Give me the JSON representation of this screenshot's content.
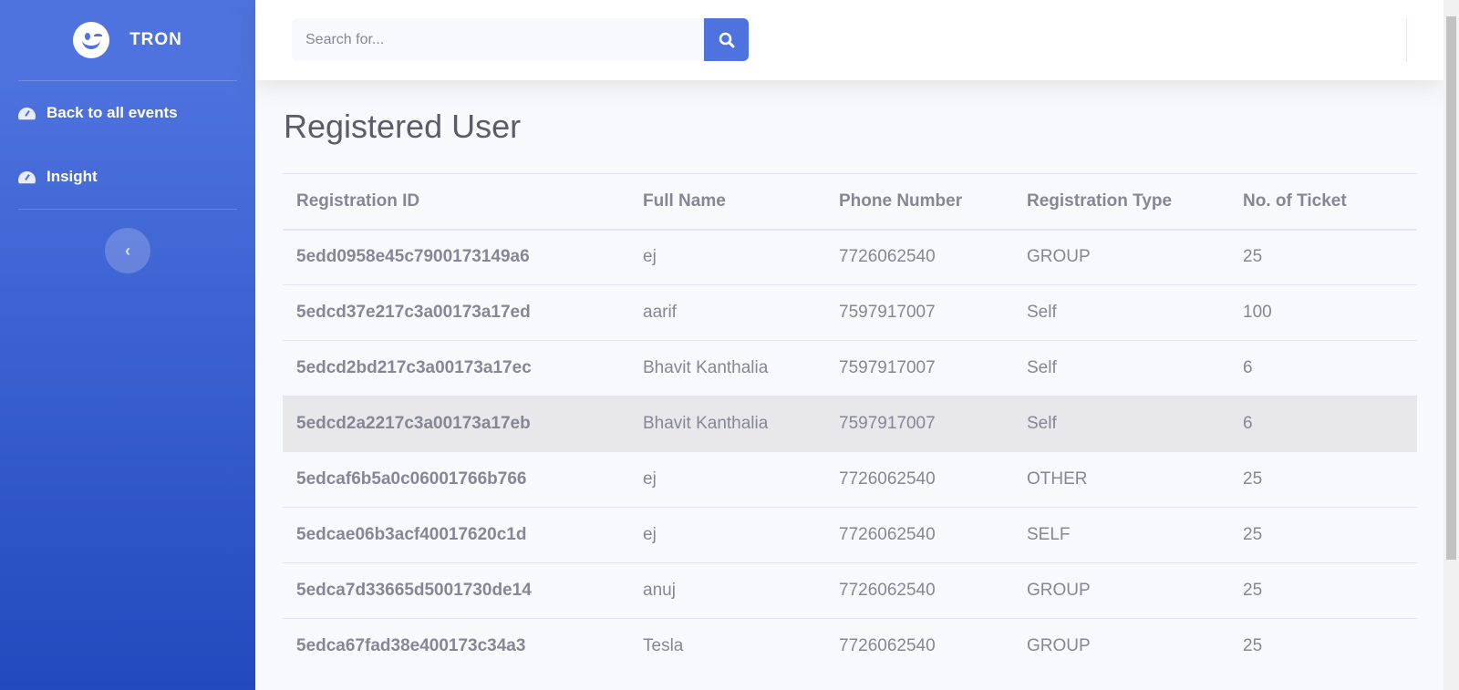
{
  "brand": {
    "name": "TRON",
    "logo_icon": "winking-face-icon"
  },
  "sidebar": {
    "items": [
      {
        "label": "Back to all events",
        "icon": "tachometer-icon"
      },
      {
        "label": "Insight",
        "icon": "tachometer-icon"
      }
    ],
    "toggle_icon": "chevron-left-icon",
    "toggle_glyph": "‹"
  },
  "search": {
    "placeholder": "Search for...",
    "value": "",
    "icon": "search-icon"
  },
  "main": {
    "title": "Registered User",
    "table": {
      "headers": [
        "Registration ID",
        "Full Name",
        "Phone Number",
        "Registration Type",
        "No. of Ticket"
      ],
      "rows": [
        [
          "5edd0958e45c7900173149a6",
          "ej",
          "7726062540",
          "GROUP",
          "25"
        ],
        [
          "5edcd37e217c3a00173a17ed",
          "aarif",
          "7597917007",
          "Self",
          "100"
        ],
        [
          "5edcd2bd217c3a00173a17ec",
          "Bhavit Kanthalia",
          "7597917007",
          "Self",
          "6"
        ],
        [
          "5edcd2a2217c3a00173a17eb",
          "Bhavit Kanthalia",
          "7597917007",
          "Self",
          "6"
        ],
        [
          "5edcaf6b5a0c06001766b766",
          "ej",
          "7726062540",
          "OTHER",
          "25"
        ],
        [
          "5edcae06b3acf40017620c1d",
          "ej",
          "7726062540",
          "SELF",
          "25"
        ],
        [
          "5edca7d33665d5001730de14",
          "anuj",
          "7726062540",
          "GROUP",
          "25"
        ],
        [
          "5edca67fad38e400173c34a3",
          "Tesla",
          "7726062540",
          "GROUP",
          "25"
        ]
      ]
    }
  },
  "colors": {
    "primary": "#4e73df",
    "text": "#858796",
    "title": "#5a5c69",
    "hover_row": "#e8e8ea"
  }
}
